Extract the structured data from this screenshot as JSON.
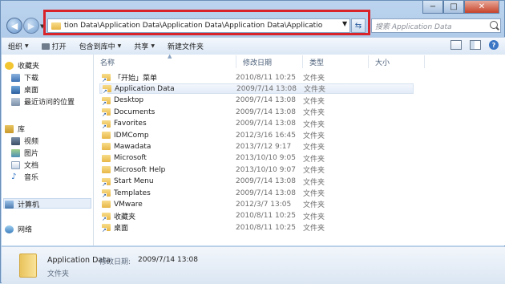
{
  "window": {
    "min_glyph": "−",
    "max_glyph": "□",
    "close_glyph": "✕"
  },
  "address": {
    "path": "tion Data\\Application Data\\Application Data\\Application Data\\Applicatio",
    "search_placeholder": "搜索 Application Data"
  },
  "toolbar": {
    "organize": "组织",
    "open": "打开",
    "include_in_library": "包含到库中",
    "share": "共享",
    "new_folder": "新建文件夹"
  },
  "nav": {
    "favorites": "收藏夹",
    "downloads": "下载",
    "desktop": "桌面",
    "recent": "最近访问的位置",
    "libraries": "库",
    "videos": "视频",
    "pictures": "图片",
    "documents": "文档",
    "music": "音乐",
    "computer": "计算机",
    "network": "网络"
  },
  "columns": {
    "name": "名称",
    "date": "修改日期",
    "type": "类型",
    "size": "大小"
  },
  "files": [
    {
      "name": "「开始」菜单",
      "date": "2010/8/11 10:25",
      "type": "文件夹",
      "icon": "shortcut-folder-icon"
    },
    {
      "name": "Application Data",
      "date": "2009/7/14 13:08",
      "type": "文件夹",
      "icon": "shortcut-folder-icon"
    },
    {
      "name": "Desktop",
      "date": "2009/7/14 13:08",
      "type": "文件夹",
      "icon": "shortcut-folder-icon"
    },
    {
      "name": "Documents",
      "date": "2009/7/14 13:08",
      "type": "文件夹",
      "icon": "shortcut-folder-icon"
    },
    {
      "name": "Favorites",
      "date": "2009/7/14 13:08",
      "type": "文件夹",
      "icon": "shortcut-folder-icon"
    },
    {
      "name": "IDMComp",
      "date": "2012/3/16 16:45",
      "type": "文件夹",
      "icon": "folder-icon"
    },
    {
      "name": "Mawadata",
      "date": "2013/7/12 9:17",
      "type": "文件夹",
      "icon": "folder-icon"
    },
    {
      "name": "Microsoft",
      "date": "2013/10/10 9:05",
      "type": "文件夹",
      "icon": "folder-icon"
    },
    {
      "name": "Microsoft Help",
      "date": "2013/10/10 9:07",
      "type": "文件夹",
      "icon": "folder-icon"
    },
    {
      "name": "Start Menu",
      "date": "2009/7/14 13:08",
      "type": "文件夹",
      "icon": "shortcut-folder-icon"
    },
    {
      "name": "Templates",
      "date": "2009/7/14 13:08",
      "type": "文件夹",
      "icon": "shortcut-folder-icon"
    },
    {
      "name": "VMware",
      "date": "2012/3/7 13:05",
      "type": "文件夹",
      "icon": "folder-icon"
    },
    {
      "name": "收藏夹",
      "date": "2010/8/11 10:25",
      "type": "文件夹",
      "icon": "shortcut-folder-icon"
    },
    {
      "name": "桌面",
      "date": "2010/8/11 10:25",
      "type": "文件夹",
      "icon": "shortcut-folder-icon"
    }
  ],
  "details": {
    "name": "Application Data",
    "date_label": "修改日期:",
    "date": "2009/7/14 13:08",
    "type": "文件夹"
  },
  "colors": {
    "highlight_border": "#d8232a",
    "selection": "#e3ecf8"
  }
}
